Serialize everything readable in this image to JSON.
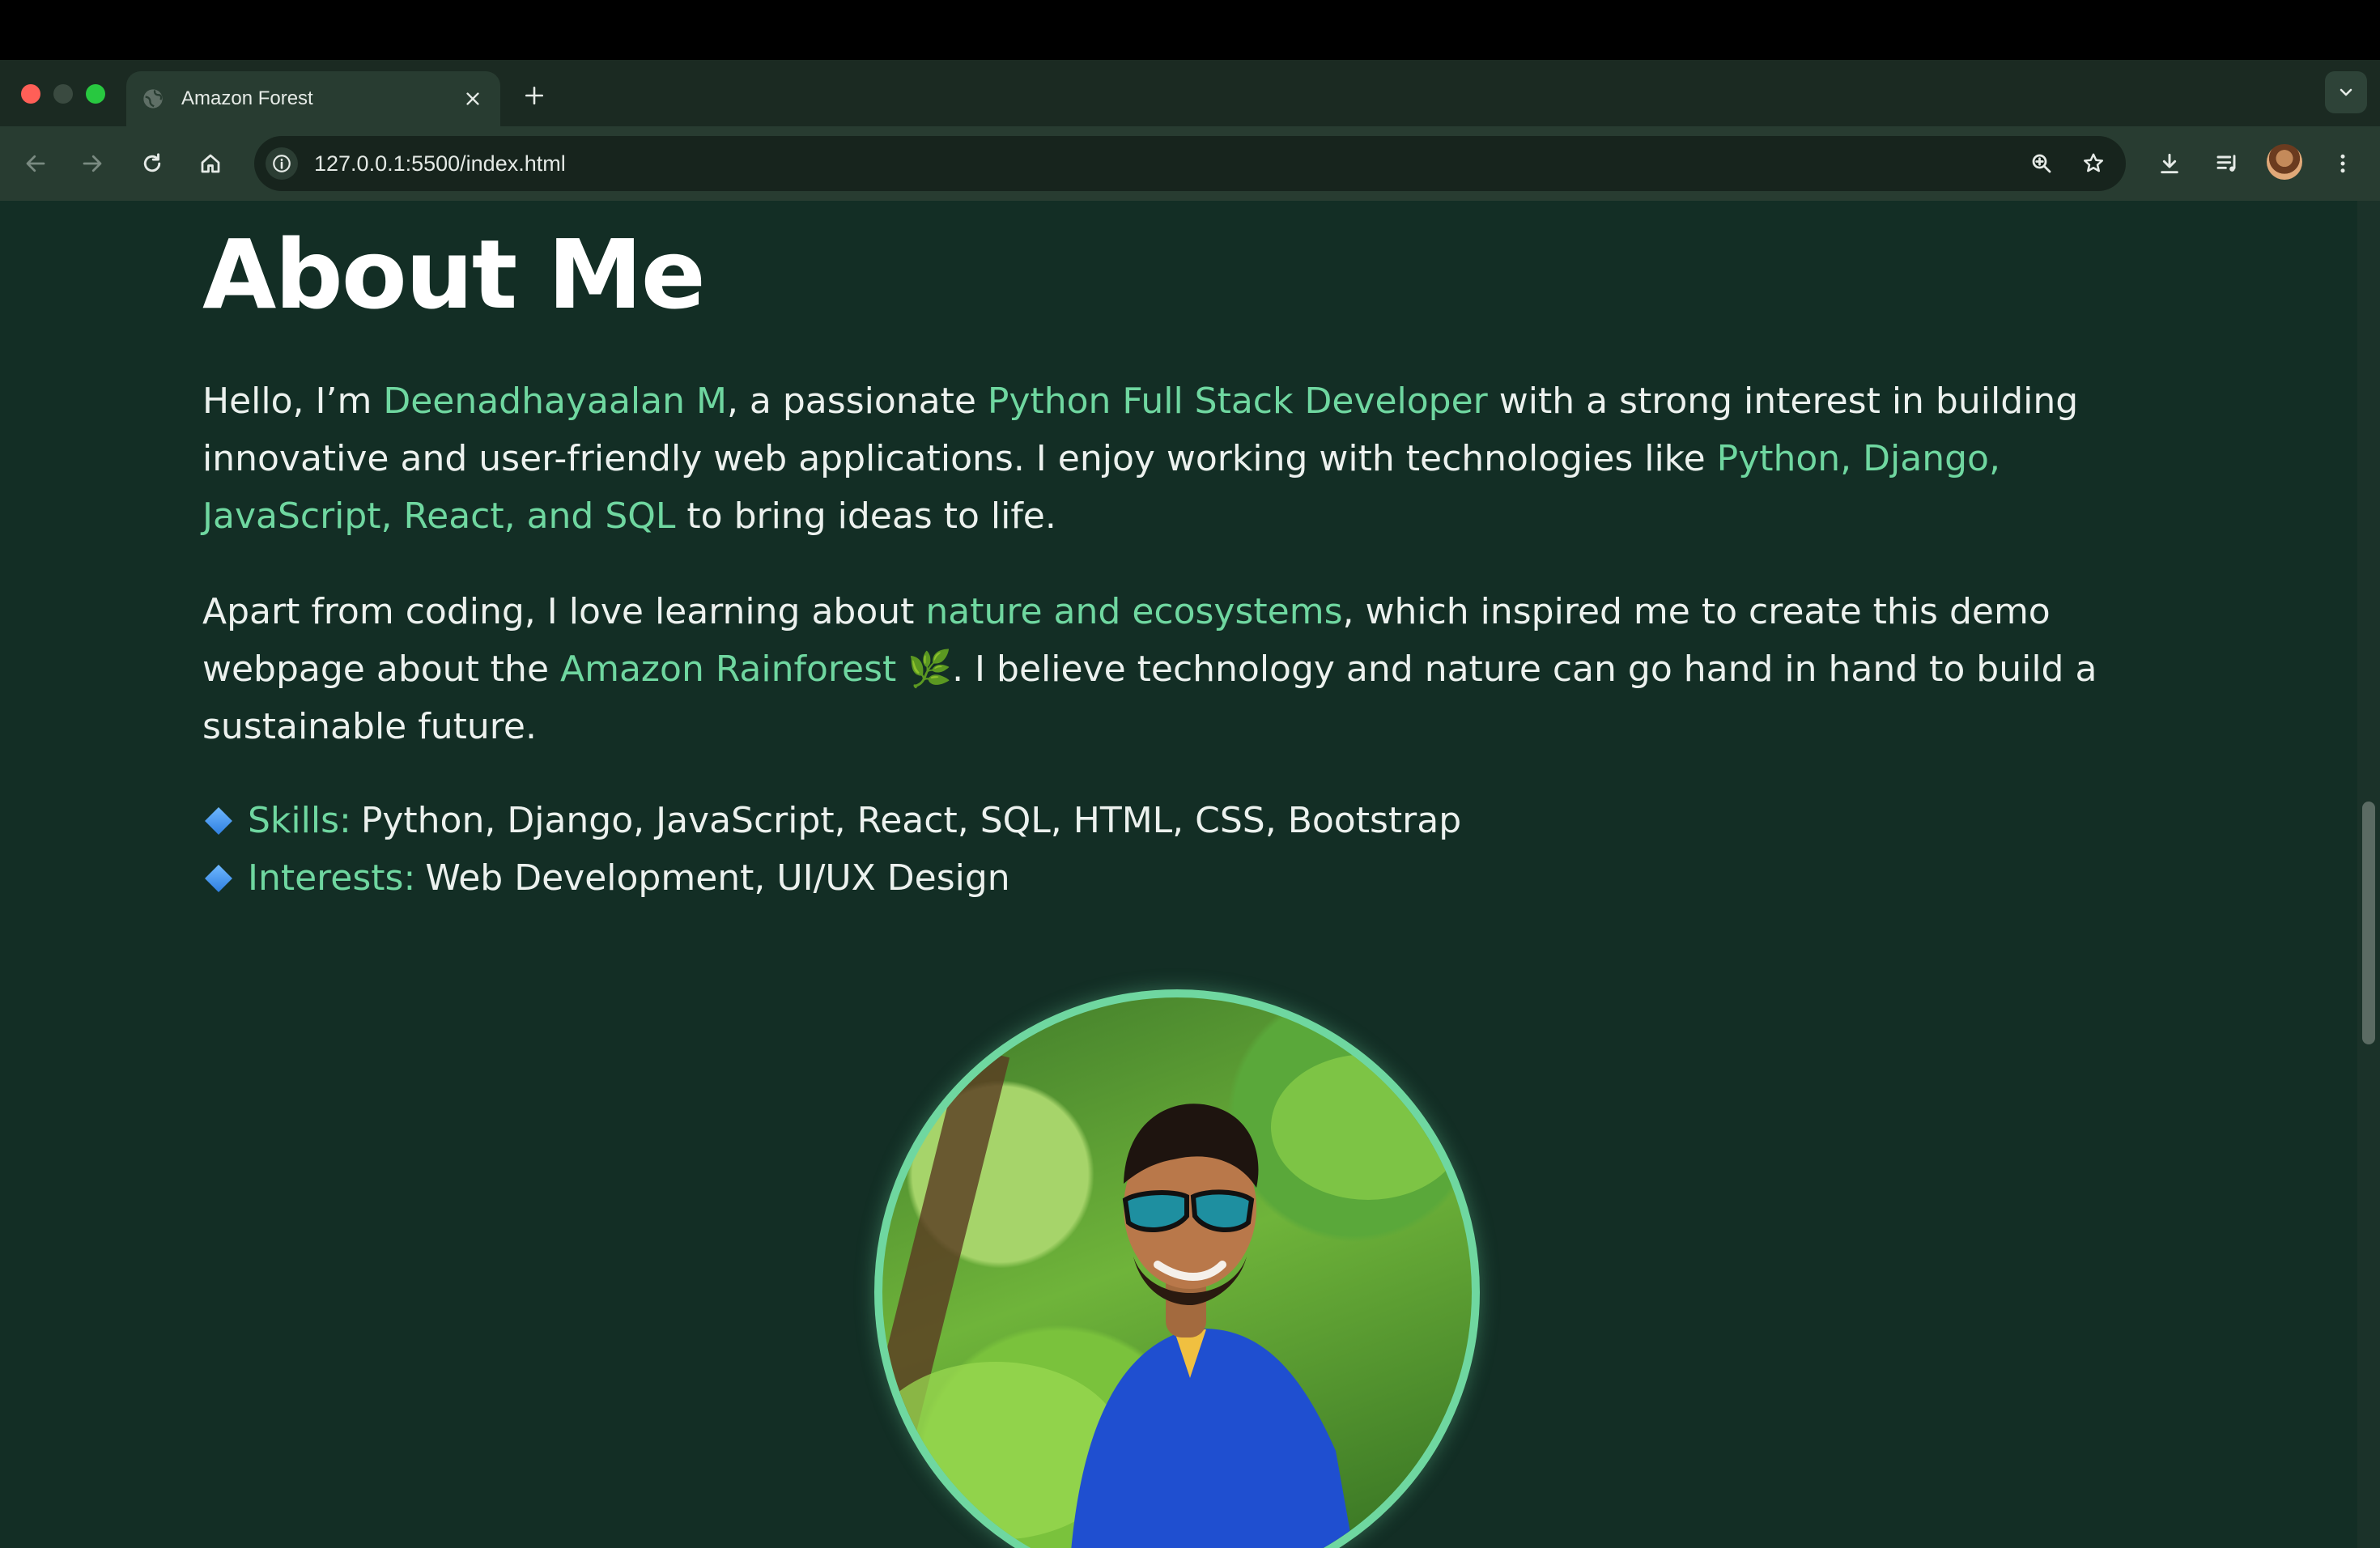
{
  "browser": {
    "tab_title": "Amazon Forest",
    "url": "127.0.0.1:5500/index.html"
  },
  "page": {
    "heading": "About Me",
    "para1": {
      "t1": "Hello, I’m ",
      "name": "Deenadhayaalan M",
      "t2": ", a passionate ",
      "role": "Python Full Stack Developer",
      "t3": " with a strong interest in building innovative and user-friendly web applications. I enjoy working with technologies like ",
      "tech": "Python, Django, JavaScript, React, and SQL",
      "t4": " to bring ideas to life."
    },
    "para2": {
      "t1": "Apart from coding, I love learning about ",
      "nature": "nature and ecosystems",
      "t2": ", which inspired me to create this demo webpage about the ",
      "amazon": "Amazon Rainforest",
      "emoji": "🌿",
      "t3": ". I believe technology and nature can go hand in hand to build a sustainable future."
    },
    "skills": {
      "label": "Skills:",
      "value": "Python, Django, JavaScript, React, SQL, HTML, CSS, Bootstrap"
    },
    "interests": {
      "label": "Interests:",
      "value": "Web Development, UI/UX Design"
    }
  },
  "colors": {
    "page_bg": "#132e25",
    "accent": "#6fd7a0",
    "text": "#ecf1ee"
  }
}
